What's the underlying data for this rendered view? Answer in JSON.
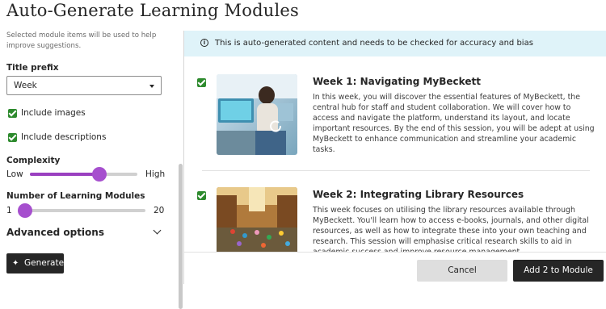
{
  "page": {
    "title": "Auto-Generate Learning Modules"
  },
  "left": {
    "helper_text": "Selected module items will be used to help improve suggestions.",
    "title_prefix_label": "Title prefix",
    "title_prefix_value": "Week",
    "include_images_label": "Include images",
    "include_images_checked": true,
    "include_descriptions_label": "Include descriptions",
    "include_descriptions_checked": true,
    "complexity": {
      "label": "Complexity",
      "min_label": "Low",
      "max_label": "High",
      "level_fraction": 0.65
    },
    "modules": {
      "label": "Number of Learning Modules",
      "min_label": "1",
      "max_label": "20",
      "value": 2
    },
    "advanced_label": "Advanced options",
    "generate_label": "Generate"
  },
  "right": {
    "banner_text": "This is auto-generated content and needs to be checked for accuracy and bias",
    "modules": [
      {
        "title": "Week 1: Navigating MyBeckett",
        "description": "In this week, you will discover the essential features of MyBeckett, the central hub for staff and student collaboration. We will cover how to access and navigate the platform, understand its layout, and locate important resources. By the end of this session, you will be adept at using MyBeckett to enhance communication and streamline your academic tasks.",
        "checked": true
      },
      {
        "title": "Week 2: Integrating Library Resources",
        "description": "This week focuses on utilising the library resources available through MyBeckett. You'll learn how to access e-books, journals, and other digital resources, as well as how to integrate these into your own teaching and research. This session will emphasise critical research skills to aid in academic success and improve resource management.",
        "checked": true
      }
    ],
    "cancel_label": "Cancel",
    "add_label": "Add 2 to Module"
  },
  "colors": {
    "accent": "#a64fce",
    "checkbox": "#2d8a2d",
    "banner": "#dff3f9",
    "primary_button": "#262626"
  }
}
